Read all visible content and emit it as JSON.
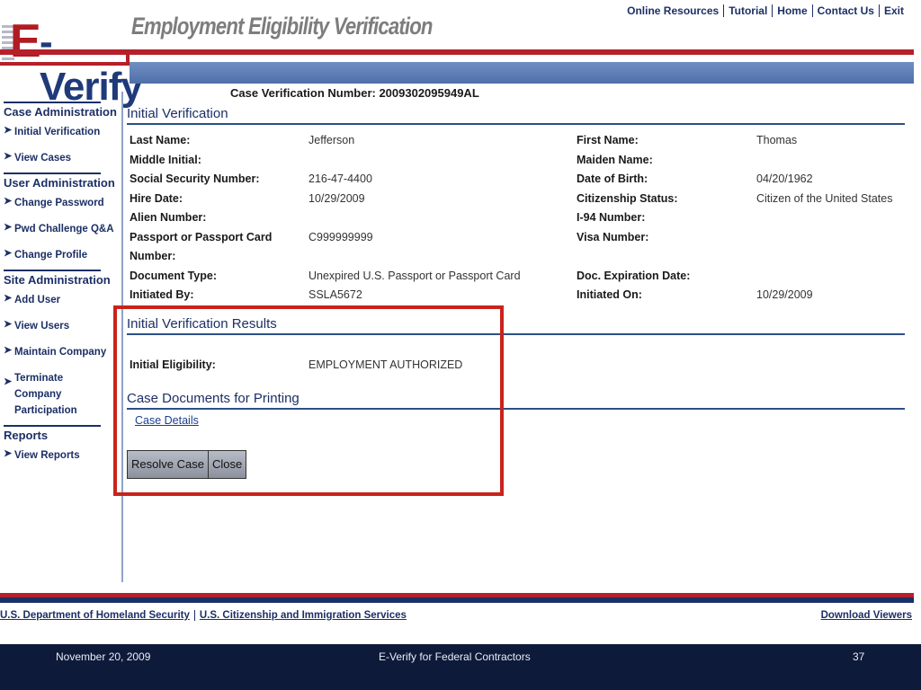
{
  "header": {
    "logo_e": "E",
    "logo_text": "-Verify",
    "title": "Employment Eligibility Verification",
    "nav": [
      "Online Resources",
      "Tutorial",
      "Home",
      "Contact Us",
      "Exit"
    ]
  },
  "sidebar": {
    "case_admin": {
      "heading": "Case Administration",
      "items": [
        "Initial Verification",
        "View Cases"
      ]
    },
    "user_admin": {
      "heading": "User Administration",
      "items": [
        "Change Password",
        "Pwd Challenge Q&A",
        "Change Profile"
      ]
    },
    "site_admin": {
      "heading": "Site Administration",
      "items": [
        "Add User",
        "View Users",
        "Maintain Company",
        "Terminate Company Participation"
      ]
    },
    "reports": {
      "heading": "Reports",
      "items": [
        "View Reports"
      ]
    }
  },
  "main": {
    "case_number": "Case Verification Number: 2009302095949AL",
    "initial_verification_title": "Initial Verification",
    "fields": {
      "last_name_label": "Last Name:",
      "last_name": "Jefferson",
      "first_name_label": "First Name:",
      "first_name": "Thomas",
      "middle_initial_label": "Middle Initial:",
      "middle_initial": "",
      "maiden_name_label": "Maiden Name:",
      "maiden_name": "",
      "ssn_label": "Social Security Number:",
      "ssn": "216-47-4400",
      "dob_label": "Date of Birth:",
      "dob": "04/20/1962",
      "hire_date_label": "Hire Date:",
      "hire_date": "10/29/2009",
      "citizenship_label": "Citizenship Status:",
      "citizenship": "Citizen of the United States",
      "alien_label": "Alien Number:",
      "alien": "",
      "i94_label": "I-94 Number:",
      "i94": "",
      "passport_label": "Passport or Passport Card Number:",
      "passport": "C999999999",
      "visa_label": "Visa Number:",
      "visa": "",
      "doc_type_label": "Document Type:",
      "doc_type": "Unexpired U.S. Passport or Passport Card",
      "doc_exp_label": "Doc. Expiration Date:",
      "doc_exp": "",
      "initiated_by_label": "Initiated By:",
      "initiated_by": "SSLA5672",
      "initiated_on_label": "Initiated On:",
      "initiated_on": "10/29/2009"
    },
    "results_title": "Initial Verification Results",
    "eligibility_label": "Initial Eligibility:",
    "eligibility_value": "EMPLOYMENT AUTHORIZED",
    "documents_title": "Case Documents for Printing",
    "case_details_link": "Case Details",
    "resolve_button": "Resolve Case",
    "close_button": "Close"
  },
  "footer": {
    "dhs_link": "U.S. Department of Homeland Security",
    "uscis_link": "U.S. Citizenship and Immigration Services",
    "download_link": "Download Viewers"
  },
  "slide": {
    "date": "November 20, 2009",
    "title": "E-Verify for Federal Contractors",
    "page": "37"
  },
  "colors": {
    "accent_red": "#b5202a",
    "navy": "#1c2f66",
    "highlight_red": "#c8231b"
  }
}
